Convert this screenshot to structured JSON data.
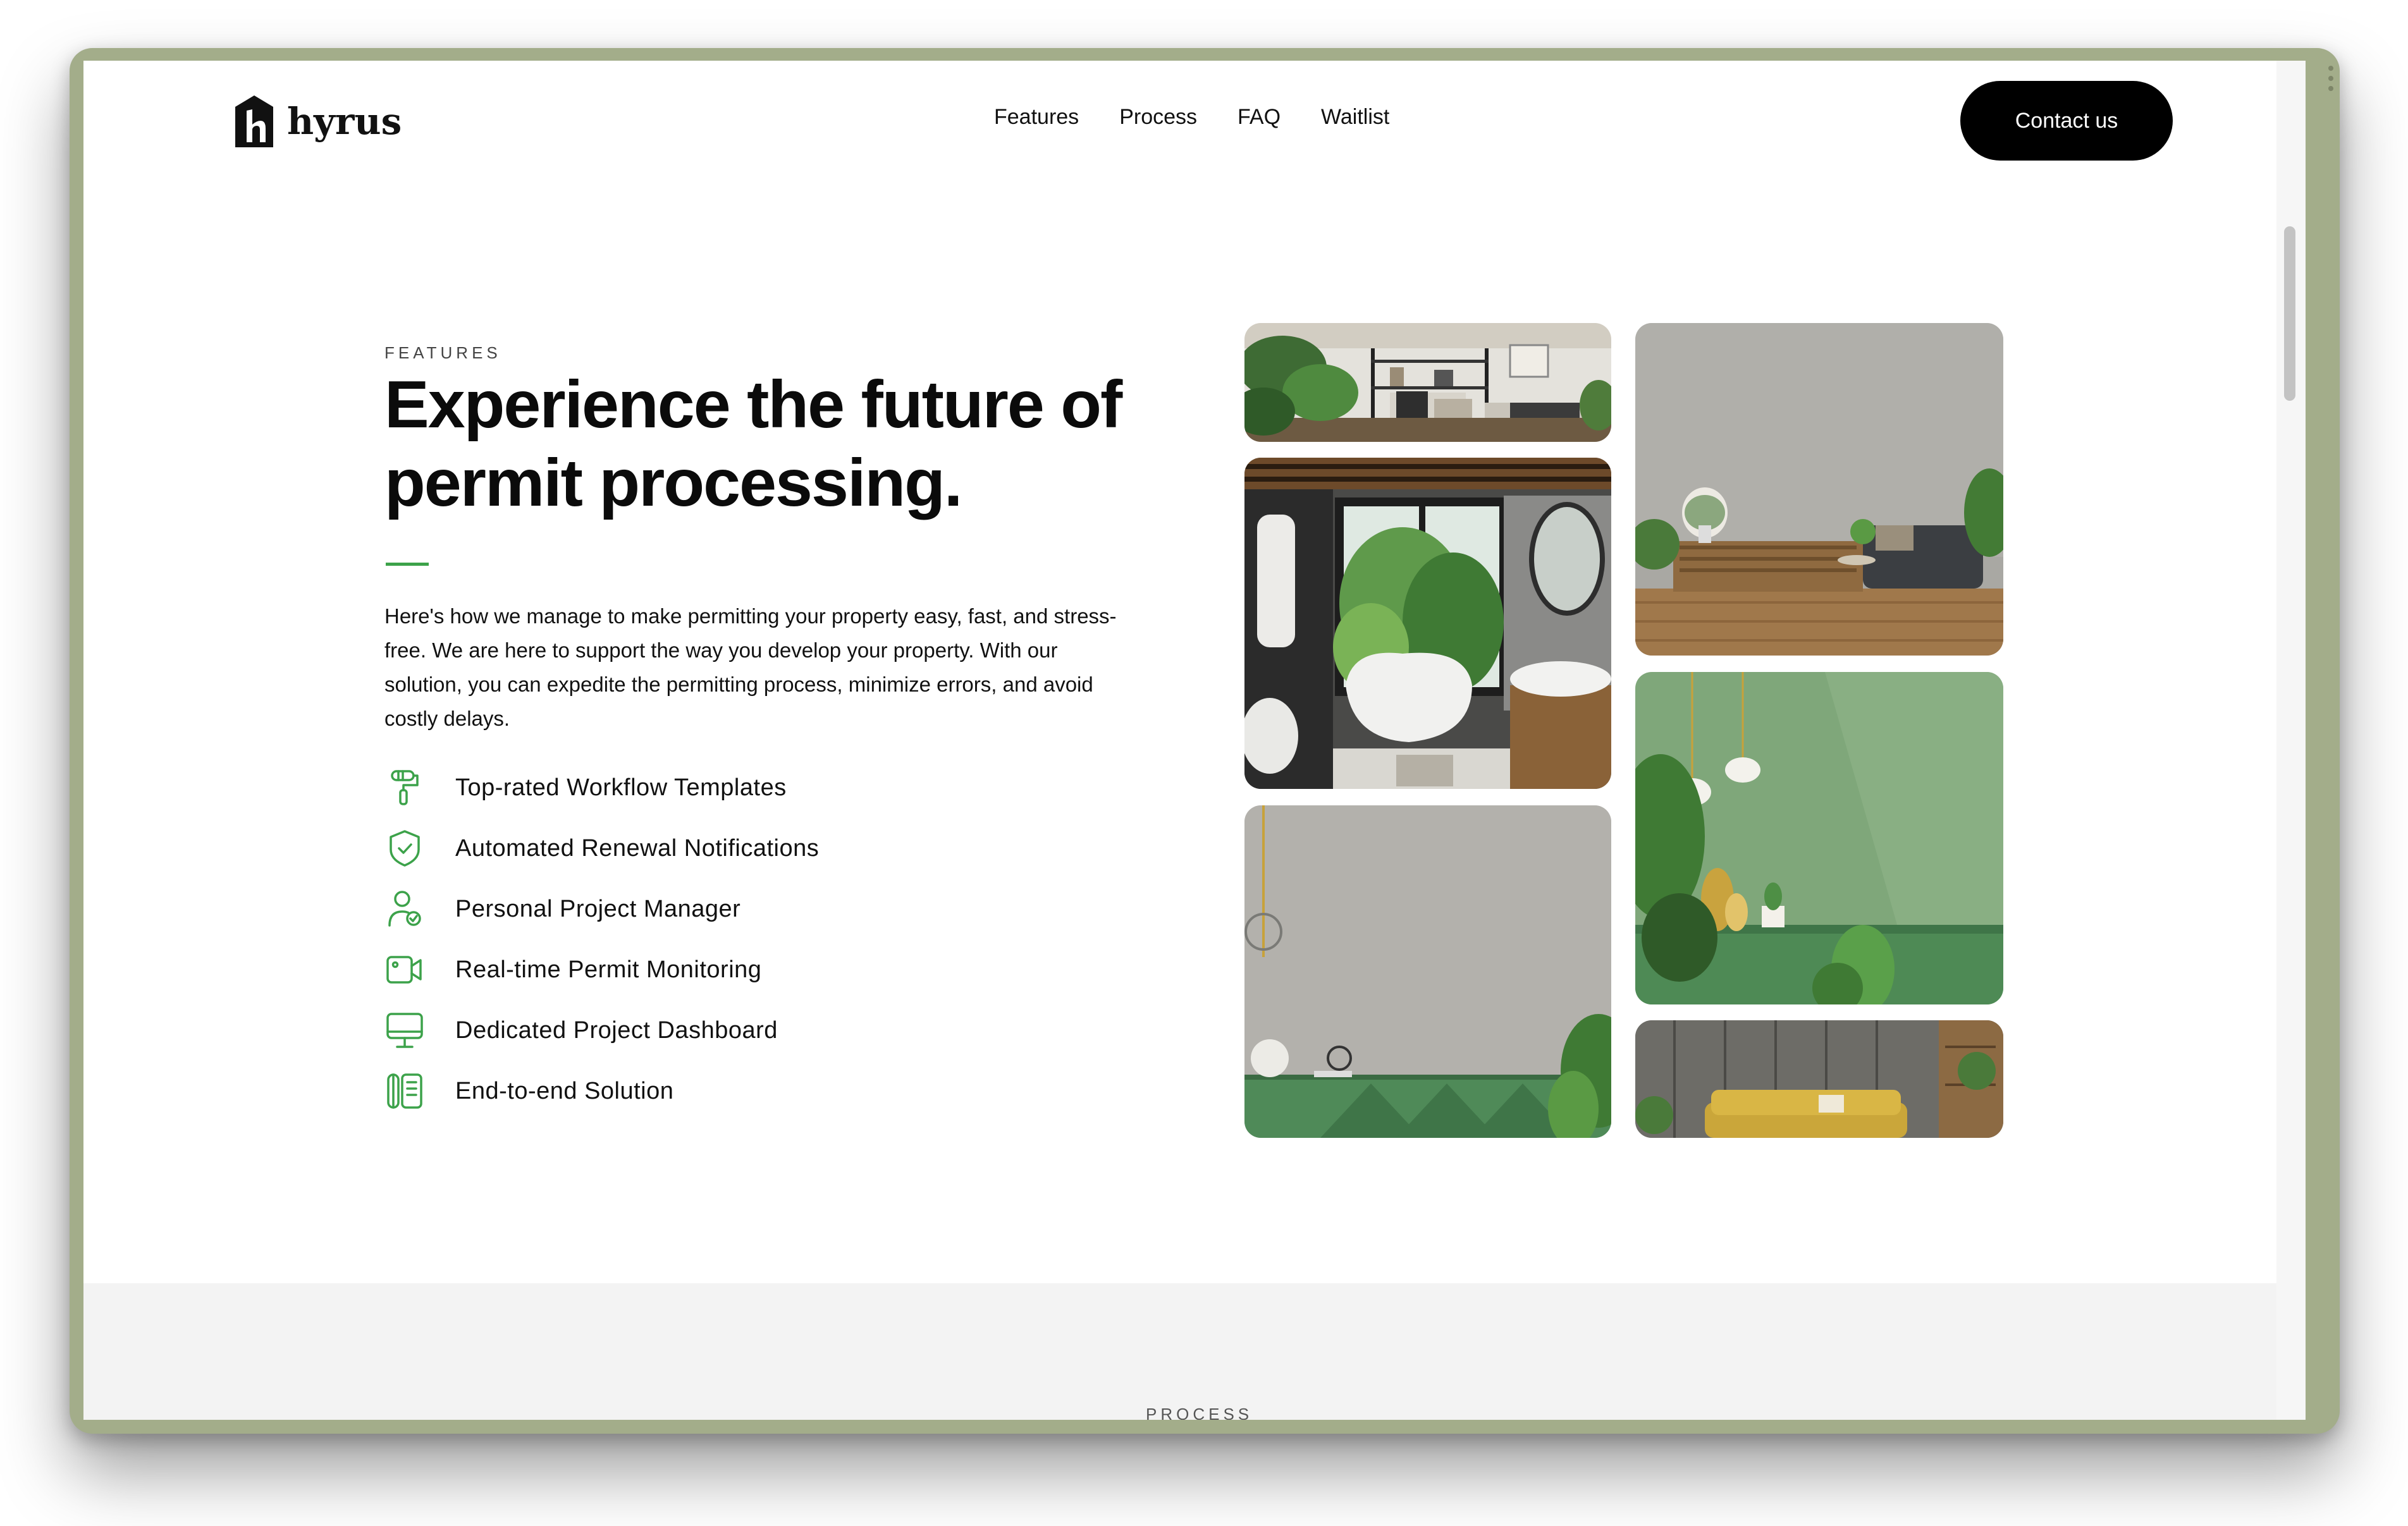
{
  "header": {
    "brand": "hyrus",
    "nav": [
      "Features",
      "Process",
      "FAQ",
      "Waitlist"
    ],
    "contact_label": "Contact us"
  },
  "features_section": {
    "eyebrow": "FEATURES",
    "headline_line1": "Experience the future of",
    "headline_line2": "permit processing.",
    "intro": "Here's how we manage to make permitting your property easy, fast, and stress-free. We are here to support the way you develop your property. With our solution, you can expedite the permitting process, minimize errors, and avoid costly delays.",
    "items": [
      {
        "label": "Top-rated Workflow Templates",
        "icon": "paint-roller-icon"
      },
      {
        "label": "Automated Renewal Notifications",
        "icon": "shield-check-icon"
      },
      {
        "label": "Personal Project Manager",
        "icon": "user-check-icon"
      },
      {
        "label": "Real-time Permit Monitoring",
        "icon": "video-camera-icon"
      },
      {
        "label": "Dedicated Project Dashboard",
        "icon": "monitor-icon"
      },
      {
        "label": "End-to-end Solution",
        "icon": "columns-icon"
      }
    ],
    "accent_color": "#3ca24a"
  },
  "process_section": {
    "eyebrow": "PROCESS"
  }
}
